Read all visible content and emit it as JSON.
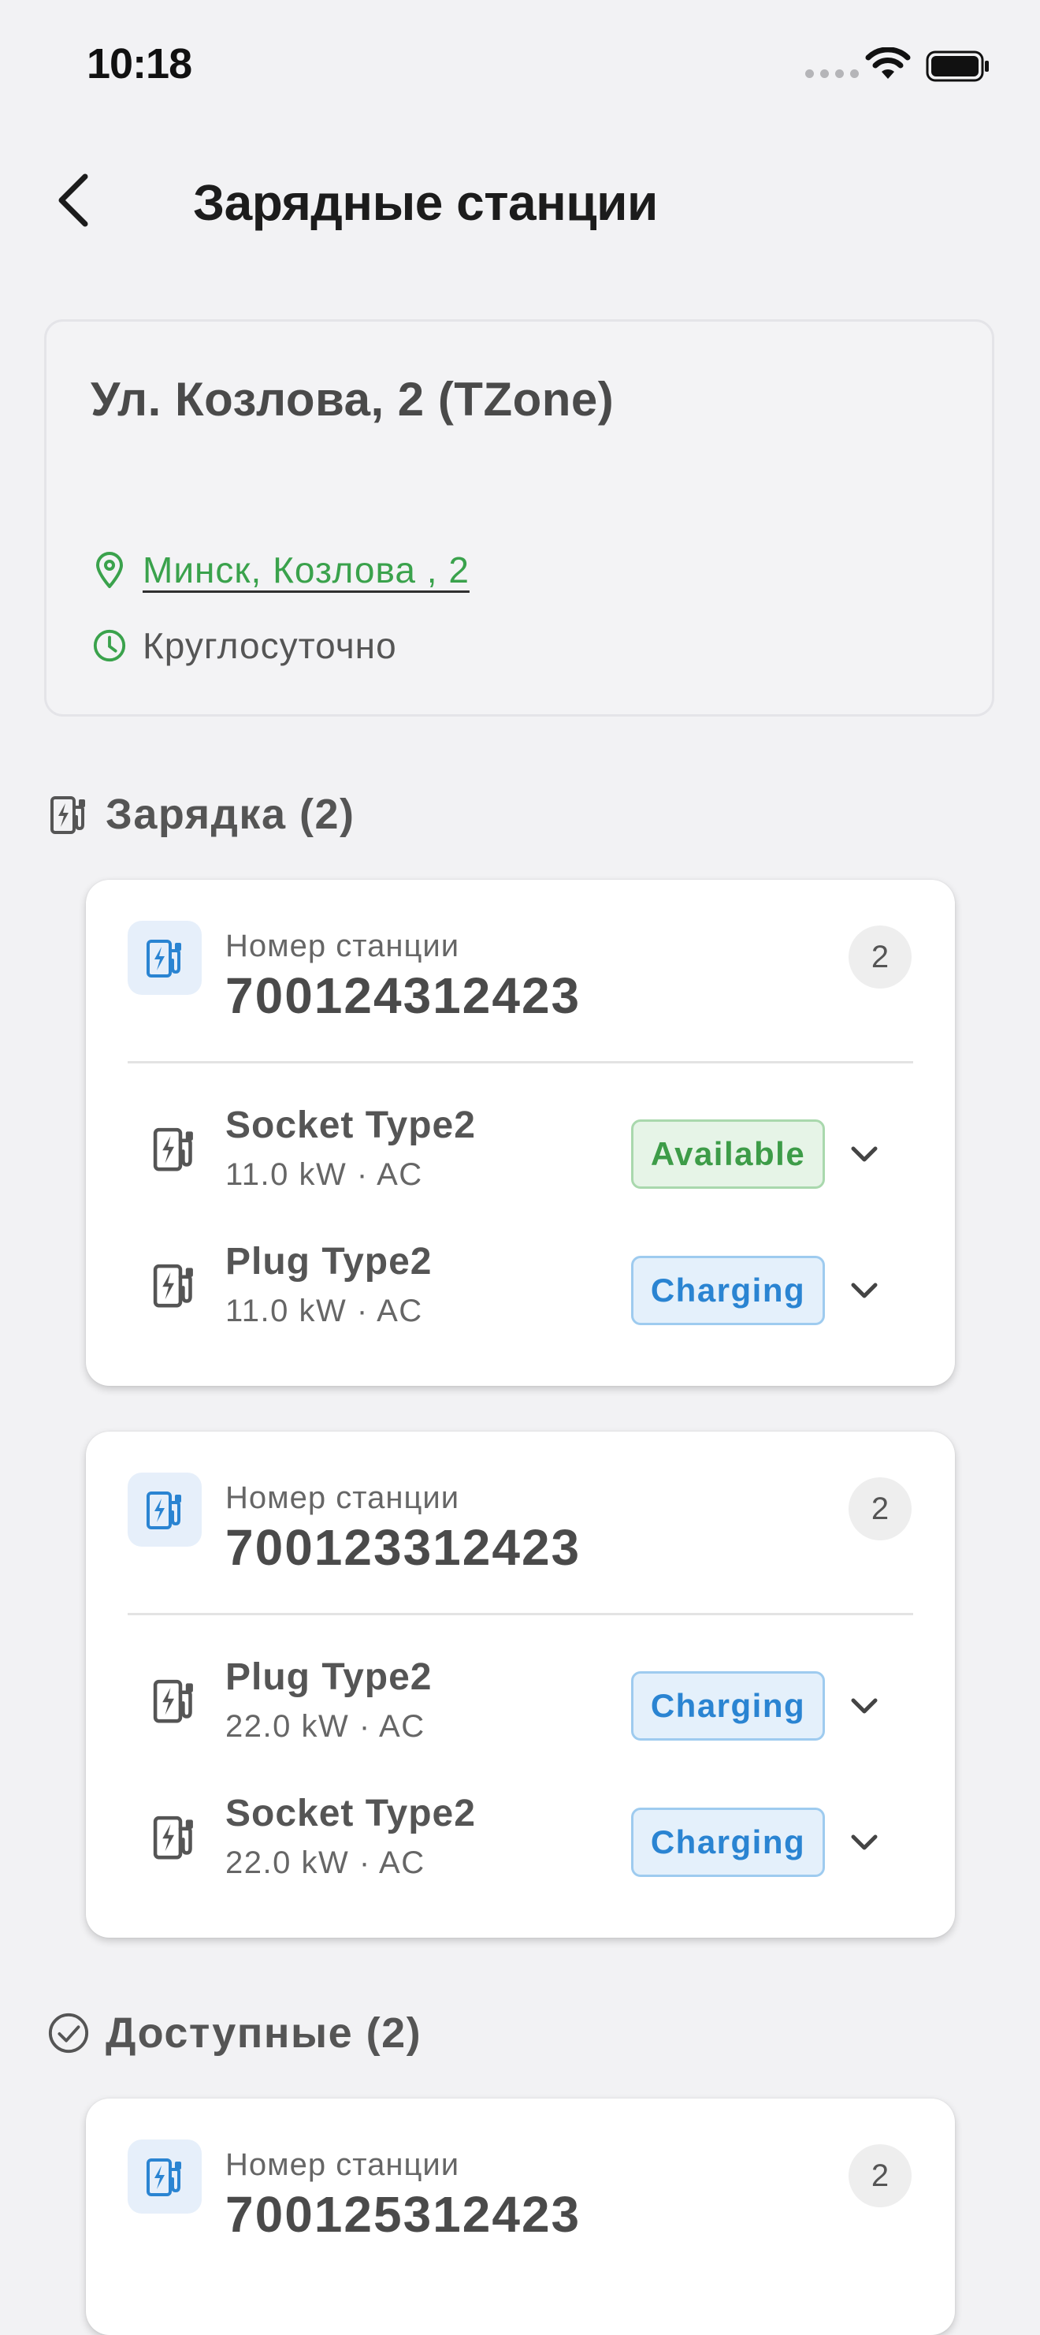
{
  "status_bar": {
    "time": "10:18"
  },
  "header": {
    "title": "Зарядные станции"
  },
  "location": {
    "name": "Ул. Козлова, 2 (TZone)",
    "address": "Минск, Козлова , 2",
    "hours": "Круглосуточно"
  },
  "sections": {
    "charging": {
      "title": "Зарядка (2)",
      "icon": "ev-station-icon"
    },
    "available": {
      "title": "Доступные (2)",
      "icon": "check-circle-icon"
    }
  },
  "stations": [
    {
      "label": "Номер станции",
      "number": "700124312423",
      "count": "2",
      "connectors": [
        {
          "name": "Socket Type2",
          "spec": "11.0 kW · AC",
          "status": "Available"
        },
        {
          "name": "Plug Type2",
          "spec": "11.0 kW · AC",
          "status": "Charging"
        }
      ]
    },
    {
      "label": "Номер станции",
      "number": "700123312423",
      "count": "2",
      "connectors": [
        {
          "name": "Plug Type2",
          "spec": "22.0 kW · AC",
          "status": "Charging"
        },
        {
          "name": "Socket Type2",
          "spec": "22.0 kW · AC",
          "status": "Charging"
        }
      ]
    },
    {
      "label": "Номер станции",
      "number": "700125312423",
      "count": "2",
      "connectors": []
    }
  ],
  "colors": {
    "accent_green": "#3aa24c",
    "station_blue": "#2a84d2",
    "background": "#f2f2f4"
  }
}
